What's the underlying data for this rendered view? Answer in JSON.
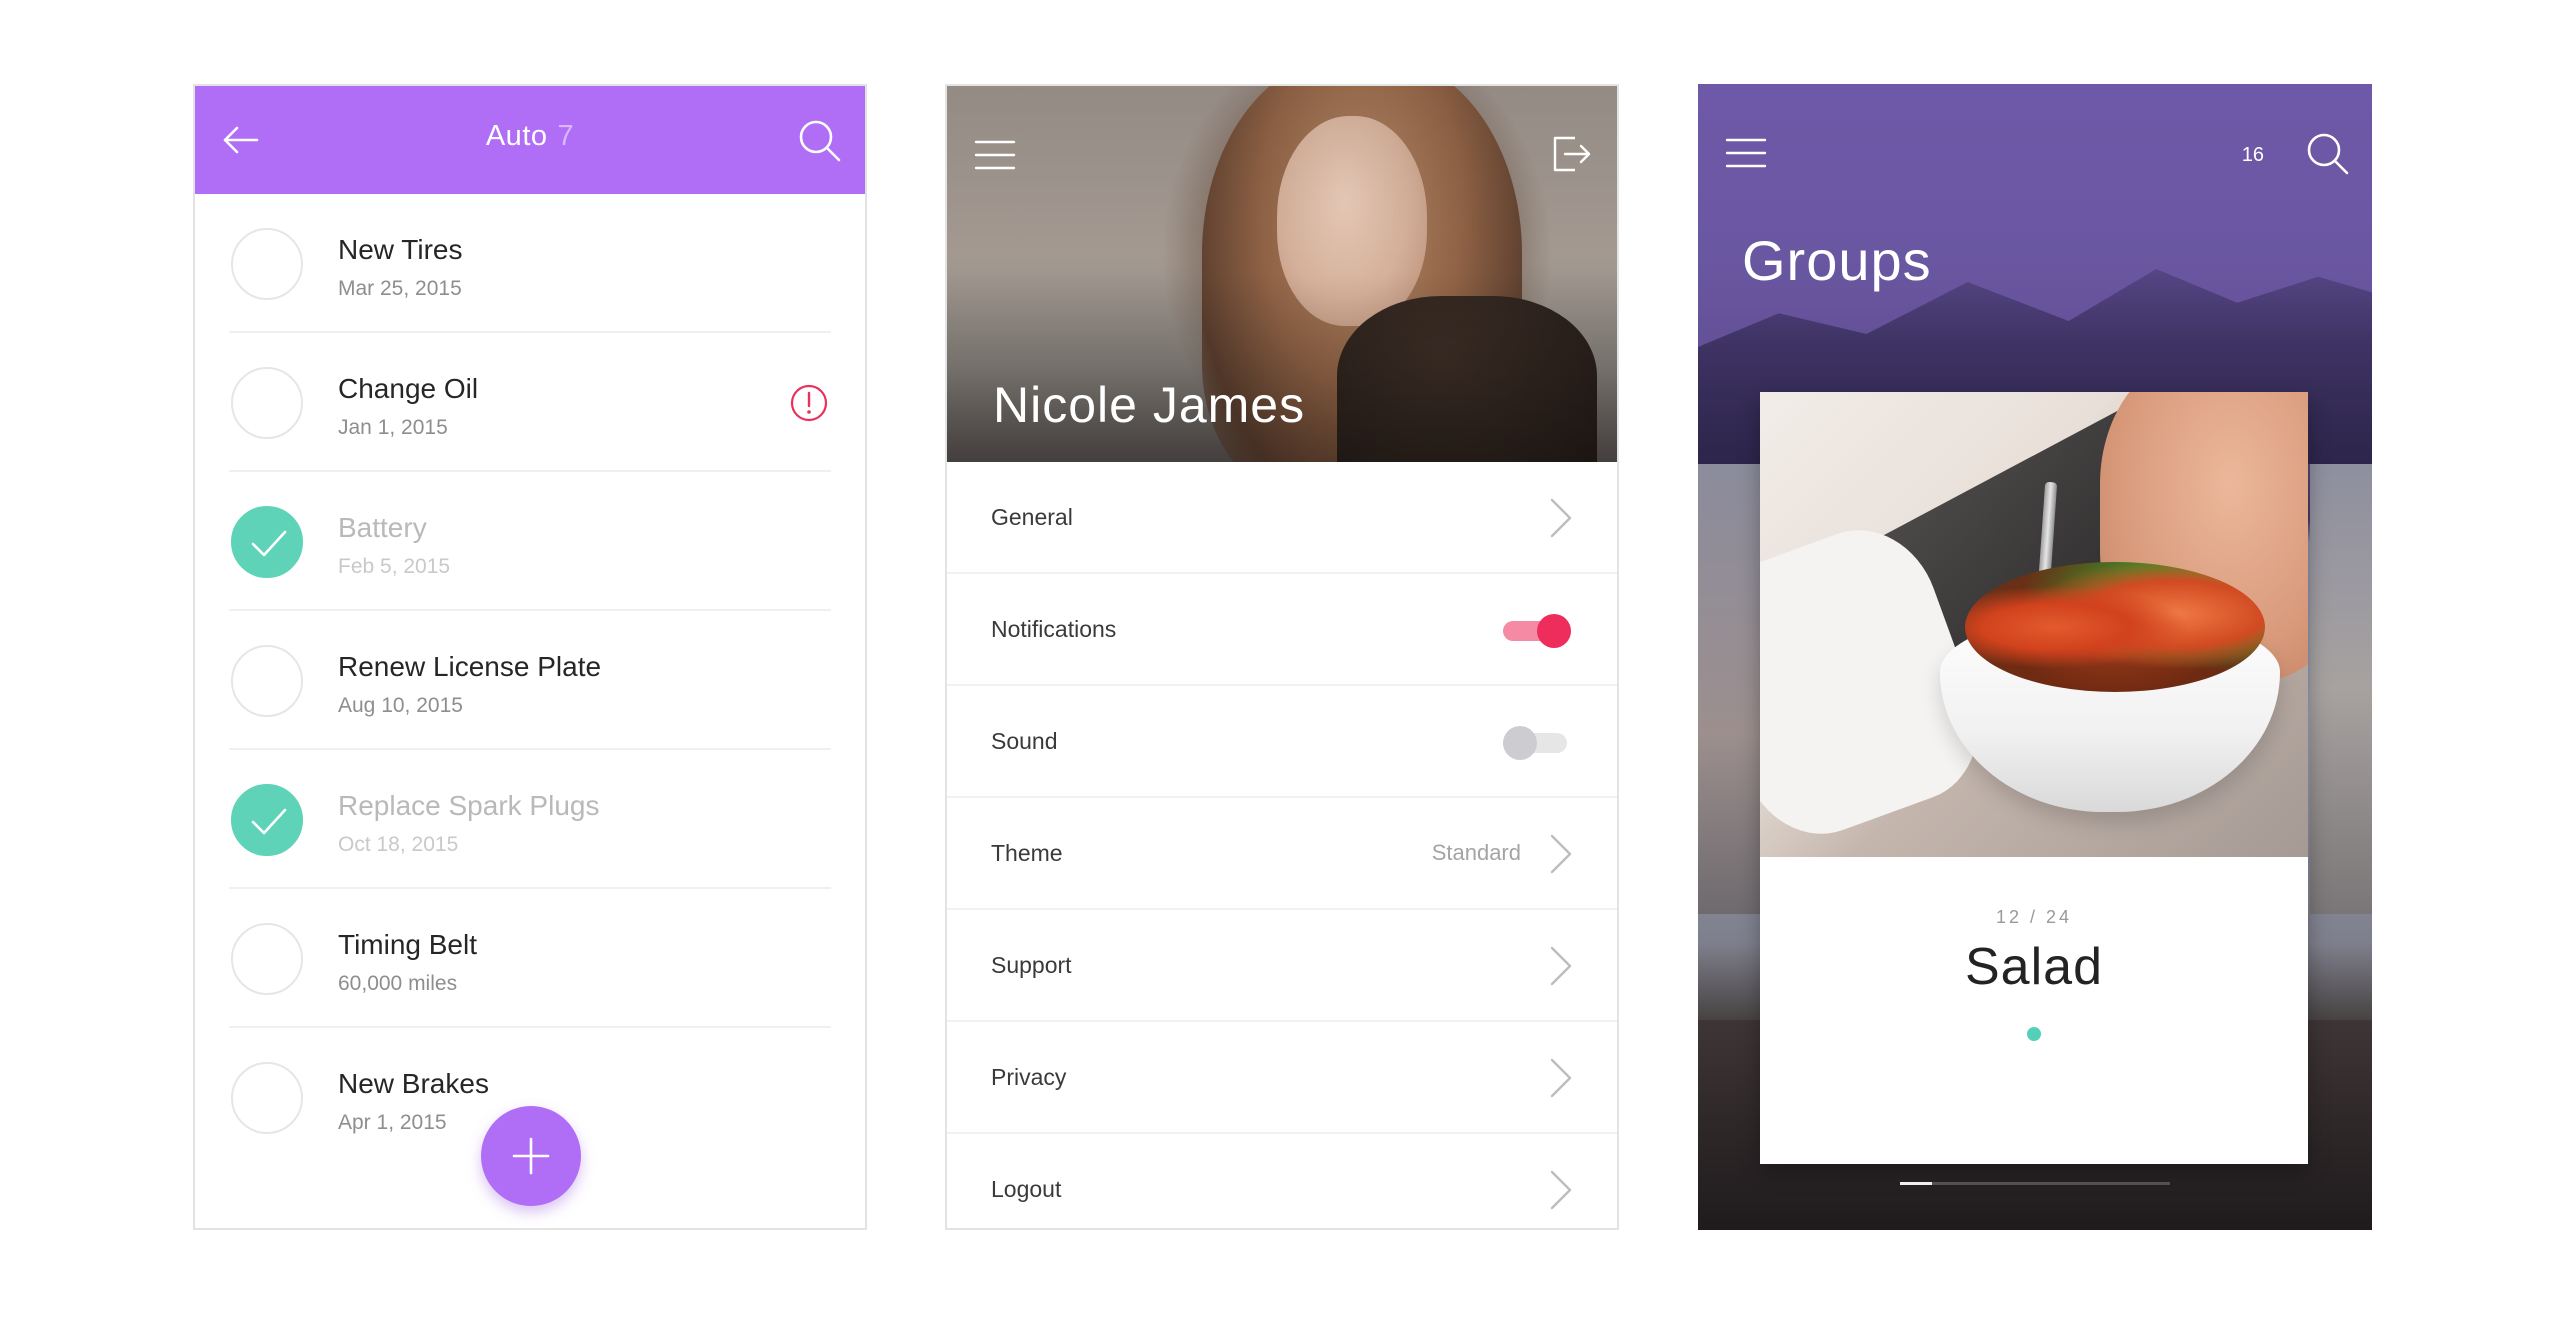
{
  "tasks_screen": {
    "title": "Auto",
    "count": "7",
    "items": [
      {
        "name": "New Tires",
        "date": "Mar 25, 2015",
        "done": false,
        "alert": false
      },
      {
        "name": "Change Oil",
        "date": "Jan 1, 2015",
        "done": false,
        "alert": true
      },
      {
        "name": "Battery",
        "date": "Feb 5, 2015",
        "done": true,
        "alert": false
      },
      {
        "name": "Renew License Plate",
        "date": "Aug 10, 2015",
        "done": false,
        "alert": false
      },
      {
        "name": "Replace Spark Plugs",
        "date": "Oct 18, 2015",
        "done": true,
        "alert": false
      },
      {
        "name": "Timing Belt",
        "date": "60,000 miles",
        "done": false,
        "alert": false
      },
      {
        "name": "New Brakes",
        "date": "Apr 1, 2015",
        "done": false,
        "alert": false
      }
    ],
    "icons": {
      "back": "arrow-left-icon",
      "search": "search-icon",
      "alert": "exclamation-circle-icon",
      "check": "check-icon",
      "add": "plus-icon"
    },
    "colors": {
      "accent": "#b06ef6",
      "done": "#5ed3b8",
      "alert": "#e8325e"
    }
  },
  "settings_screen": {
    "profile_name": "Nicole James",
    "rows": [
      {
        "label": "General",
        "control": "chevron"
      },
      {
        "label": "Notifications",
        "control": "toggle",
        "on": true
      },
      {
        "label": "Sound",
        "control": "toggle",
        "on": false
      },
      {
        "label": "Theme",
        "control": "chevron",
        "value": "Standard"
      },
      {
        "label": "Support",
        "control": "chevron"
      },
      {
        "label": "Privacy",
        "control": "chevron"
      },
      {
        "label": "Logout",
        "control": "chevron"
      }
    ],
    "icons": {
      "menu": "hamburger-menu-icon",
      "logout": "logout-icon",
      "chevron": "chevron-right-icon"
    },
    "colors": {
      "toggle_on": "#ee2d5c",
      "toggle_off": "#cdccd0"
    }
  },
  "groups_screen": {
    "title": "Groups",
    "count": "16",
    "card": {
      "index": "12 / 24",
      "name": "Salad"
    },
    "progress": 0.12,
    "icons": {
      "menu": "hamburger-menu-icon",
      "search": "search-icon"
    },
    "colors": {
      "dot": "#52d1b8",
      "header": "#6e58a8"
    }
  }
}
